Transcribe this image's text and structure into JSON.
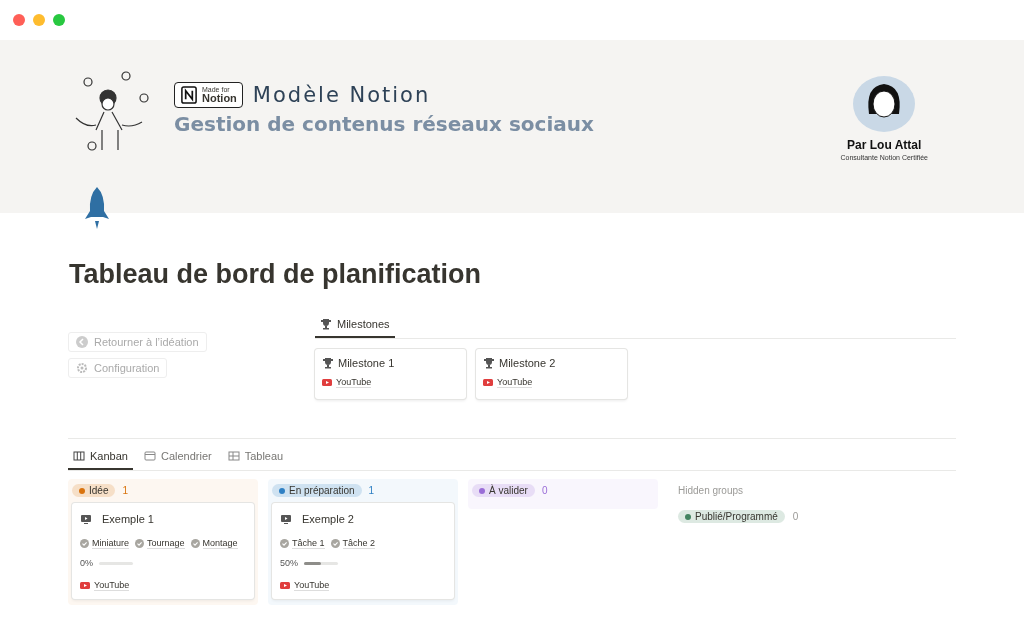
{
  "window": {
    "controls": [
      {
        "color": "#ff5f57"
      },
      {
        "color": "#febc2e"
      },
      {
        "color": "#28c840"
      }
    ]
  },
  "banner": {
    "badge_top": "Made for",
    "badge_bottom": "Notion",
    "title": "Modèle Notion",
    "subtitle": "Gestion de contenus réseaux sociaux",
    "author": "Par Lou Attal",
    "author_role": "Consultante Notion Certifiée"
  },
  "page_title": "Tableau de bord de planification",
  "actions": [
    {
      "kind": "back",
      "label": "Retourner à l’idéation"
    },
    {
      "kind": "settings",
      "label": "Configuration"
    }
  ],
  "milestones": {
    "tabs": [
      {
        "label": "Milestones",
        "selected": true
      }
    ],
    "cards": [
      {
        "title": "Milestone 1",
        "platform": "YouTube"
      },
      {
        "title": "Milestone 2",
        "platform": "YouTube"
      }
    ]
  },
  "views": [
    {
      "kind": "board",
      "label": "Kanban",
      "selected": true
    },
    {
      "kind": "calendar",
      "label": "Calendrier",
      "selected": false
    },
    {
      "kind": "table",
      "label": "Tableau",
      "selected": false
    }
  ],
  "groups": [
    {
      "label": "Idée",
      "count": "1",
      "color": "#d9730d",
      "cards": [
        {
          "title": "Exemple 1",
          "tasks": [
            "Miniature",
            "Tournage",
            "Montage"
          ],
          "progress": "0%",
          "level": 0,
          "platform": "YouTube"
        }
      ]
    },
    {
      "label": "En préparation",
      "count": "1",
      "color": "#2f80c4",
      "cards": [
        {
          "title": "Exemple 2",
          "tasks": [
            "Tâche 1",
            "Tâche 2"
          ],
          "progress": "50%",
          "level": 0.5,
          "platform": "YouTube"
        }
      ]
    },
    {
      "label": "À valider",
      "count": "0",
      "color": "#9a6dd7"
    }
  ],
  "hidden_groups": {
    "label": "Hidden groups",
    "groups": [
      {
        "label": "Publié/Programmé",
        "count": "0",
        "color": "#448361"
      }
    ]
  }
}
